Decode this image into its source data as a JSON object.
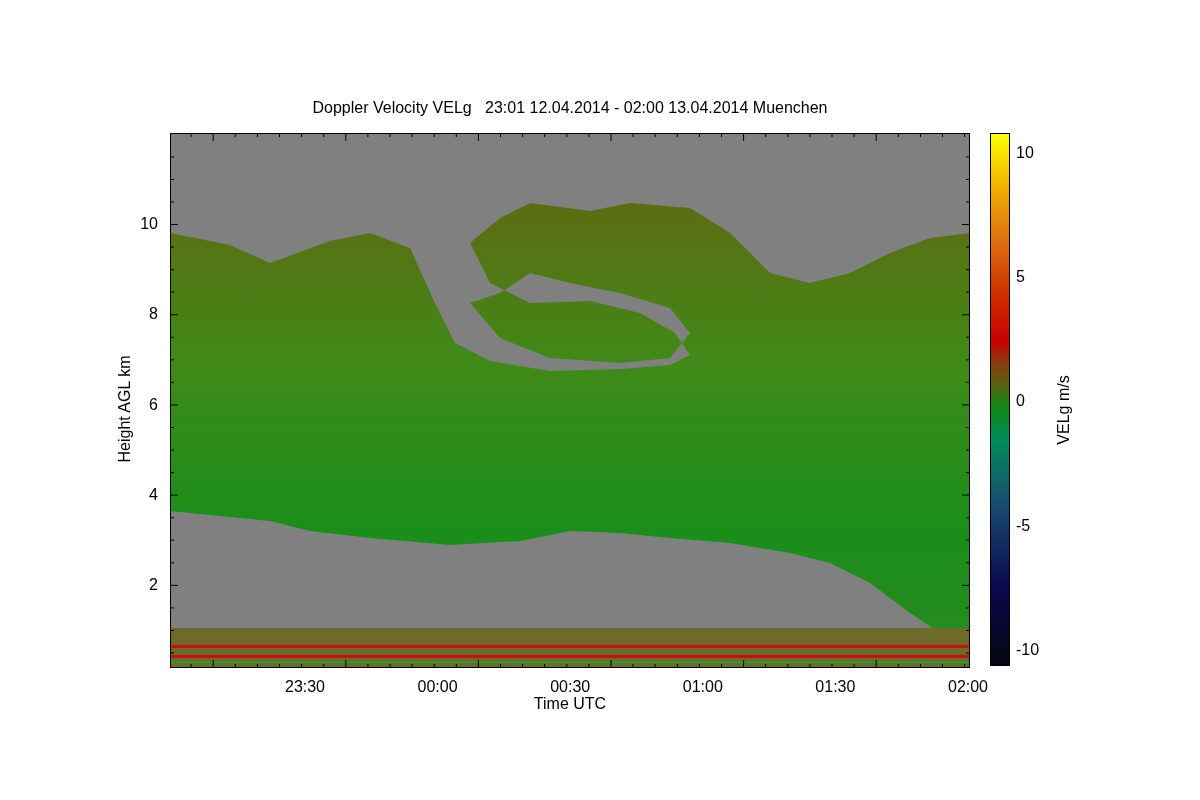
{
  "title": "Doppler Velocity VELg   23:01 12.04.2014 - 02:00 13.04.2014 Muenchen",
  "y_axis": {
    "label": "Height AGL km",
    "ticks": [
      "10",
      "8",
      "6",
      "4",
      "2"
    ]
  },
  "x_axis": {
    "label": "Time UTC",
    "ticks": [
      "23:30",
      "00:00",
      "00:30",
      "01:00",
      "01:30",
      "02:00"
    ]
  },
  "colorbar": {
    "label": "VELg m/s",
    "ticks": [
      "10",
      "5",
      "0",
      "-5",
      "-10"
    ]
  }
}
